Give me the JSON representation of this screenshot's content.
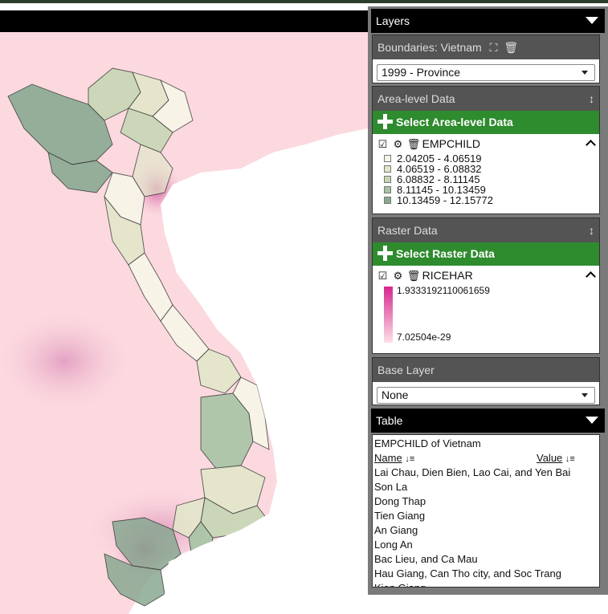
{
  "panel": {
    "layers_header": "Layers",
    "boundaries": {
      "title": "Boundaries: Vietnam",
      "selected": "1999 - Province"
    },
    "area_data": {
      "title": "Area-level Data",
      "button": "Select Area-level Data",
      "layer_name": "EMPCHILD",
      "legend": [
        {
          "label": "2.04205 - 4.06519",
          "color": "#f6f5e8"
        },
        {
          "label": "4.06519 - 6.08832",
          "color": "#e2e6ca"
        },
        {
          "label": "6.08832 - 8.11145",
          "color": "#c5d6b4"
        },
        {
          "label": "8.11145 - 10.13459",
          "color": "#a6c3a4"
        },
        {
          "label": "10.13459 - 12.15772",
          "color": "#88a892"
        }
      ]
    },
    "raster_data": {
      "title": "Raster Data",
      "button": "Select Raster Data",
      "layer_name": "RICEHAR",
      "max_label": "1.9333192110061659",
      "min_label": "7.02504e-29",
      "gradient_top": "#d6278f",
      "gradient_bottom": "#fde0e6"
    },
    "base_layer": {
      "title": "Base Layer",
      "selected": "None"
    },
    "table": {
      "header": "Table",
      "caption": "EMPCHILD of Vietnam",
      "col_name": "Name",
      "col_value": "Value",
      "rows": [
        "Lai Chau, Dien Bien, Lao Cai, and Yen Bai",
        "Son La",
        "Dong Thap",
        "Tien Giang",
        "An Giang",
        "Long An",
        "Bac Lieu, and Ca Mau",
        "Hau Giang, Can Tho city, and Soc Trang",
        "Kien Giang"
      ]
    }
  },
  "colors": {
    "accent_green": "#2e8b2e",
    "header_black": "#000000",
    "box_header_gray": "#545454",
    "raster_background": "#fbd9df"
  }
}
